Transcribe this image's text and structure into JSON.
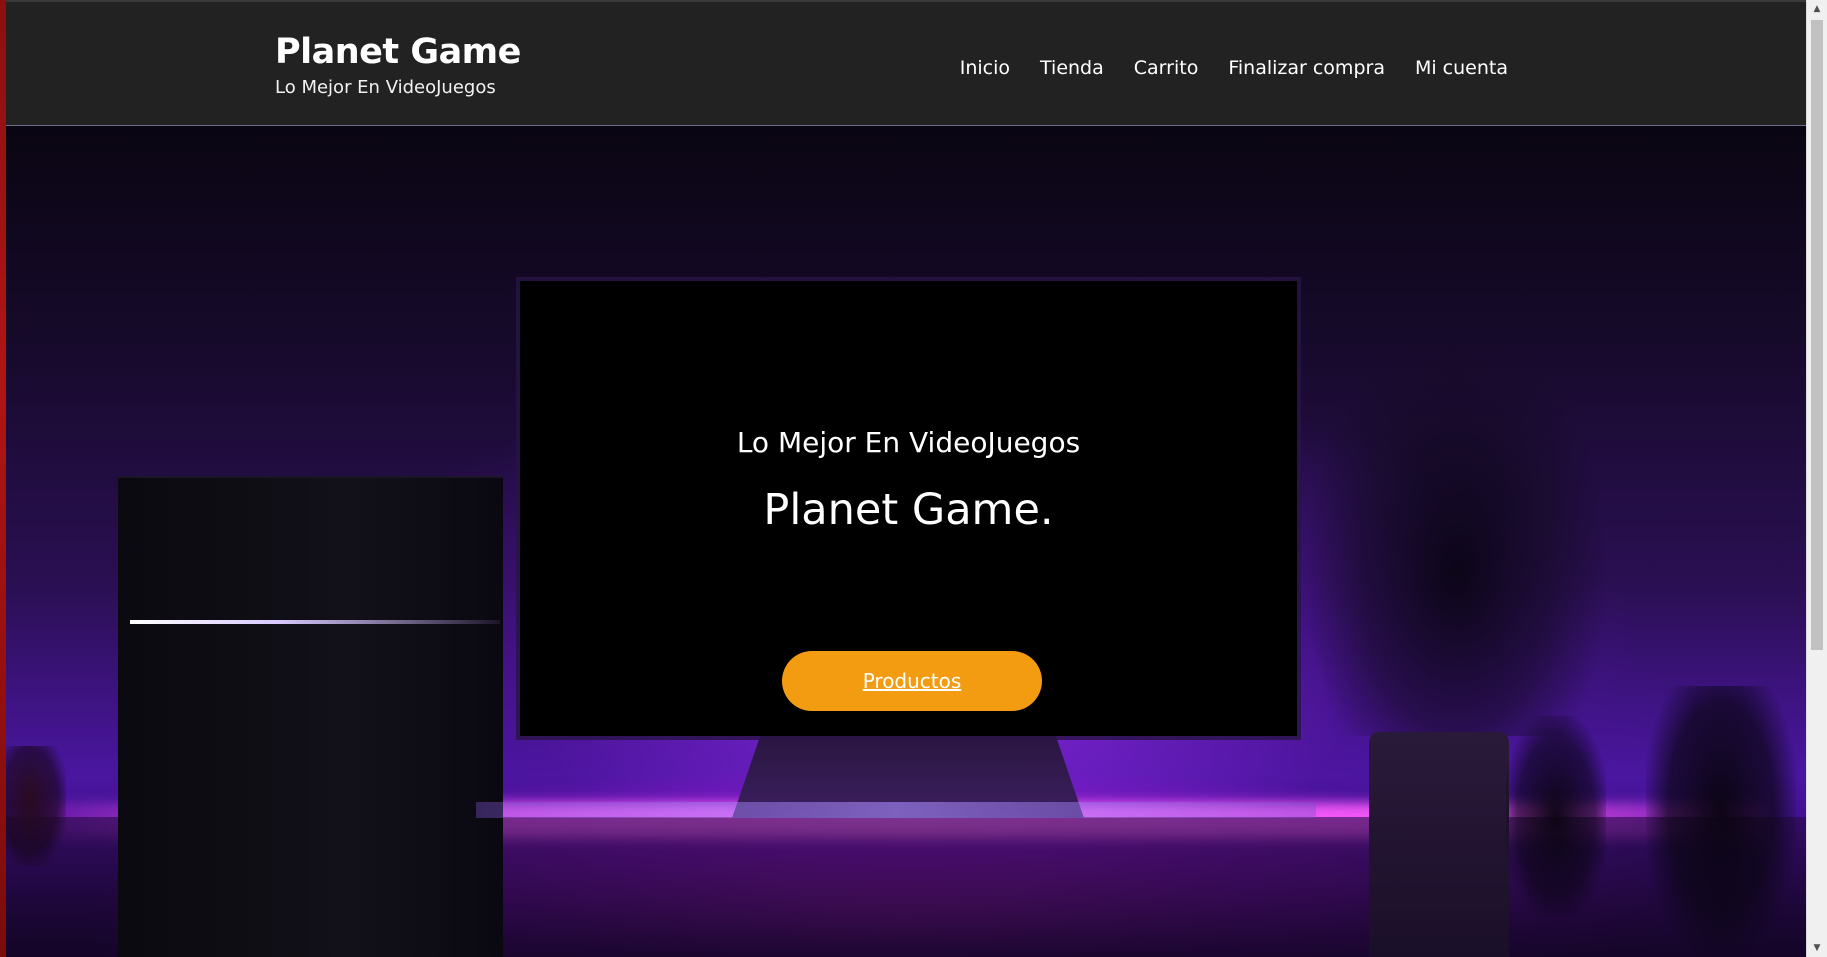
{
  "header": {
    "site_title": "Planet Game",
    "tagline": "Lo Mejor En VideoJuegos",
    "nav": [
      {
        "label": "Inicio"
      },
      {
        "label": "Tienda"
      },
      {
        "label": "Carrito"
      },
      {
        "label": "Finalizar compra"
      },
      {
        "label": "Mi cuenta"
      }
    ]
  },
  "hero": {
    "subtitle": "Lo Mejor En VideoJuegos",
    "title": "Planet Game.",
    "button_label": "Productos",
    "button_color": "#f39c12",
    "background_description_colors": [
      "#2a0f52",
      "#4a16a0",
      "#e628e6"
    ]
  },
  "scrollbar": {
    "up_icon": "chevron-up-icon",
    "down_icon": "chevron-down-icon"
  },
  "colors": {
    "header_bg": "#222222",
    "panel_bg": "#000000",
    "text": "#ffffff"
  }
}
